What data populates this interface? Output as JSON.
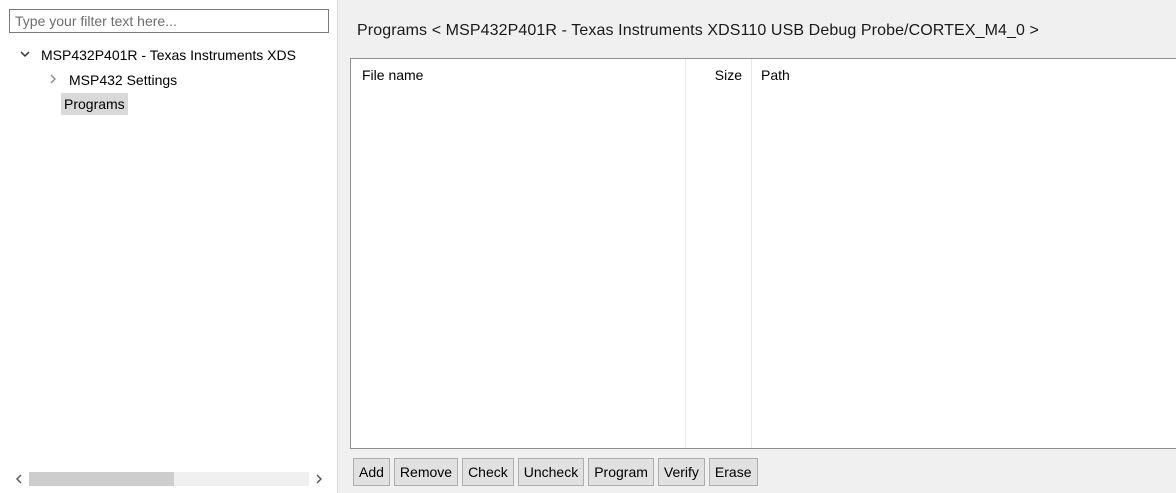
{
  "filter": {
    "placeholder": "Type your filter text here..."
  },
  "tree": {
    "root": {
      "label": "MSP432P401R - Texas Instruments XDS",
      "expanded": true,
      "twisty_icon": "chevron-down-icon"
    },
    "children": [
      {
        "label": "MSP432 Settings",
        "expanded": false,
        "twisty_icon": "chevron-right-icon"
      },
      {
        "label": "Programs",
        "selected": true
      }
    ]
  },
  "scrollbar": {
    "left_icon": "chevron-left-icon",
    "right_icon": "chevron-right-icon"
  },
  "panel": {
    "title": "Programs < MSP432P401R - Texas Instruments XDS110 USB Debug Probe/CORTEX_M4_0 >",
    "columns": {
      "file_name": "File name",
      "size": "Size",
      "path": "Path"
    },
    "rows": []
  },
  "buttons": {
    "add": "Add",
    "remove": "Remove",
    "check": "Check",
    "uncheck": "Uncheck",
    "program": "Program",
    "verify": "Verify",
    "erase": "Erase"
  },
  "colors": {
    "selection": "#d9d9d9",
    "panel_background": "#f0f0f0",
    "button_background": "#e1e1e1"
  }
}
